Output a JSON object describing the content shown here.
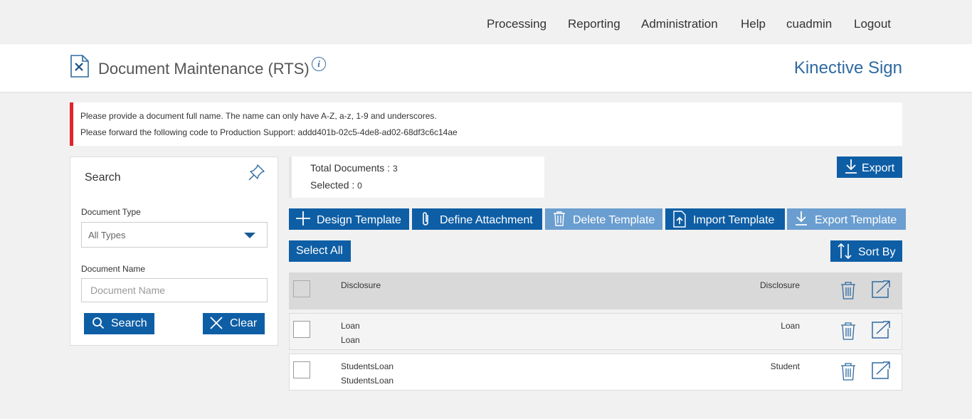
{
  "nav": {
    "items": [
      "Processing",
      "Reporting",
      "Administration",
      "Help",
      "cuadmin",
      "Logout"
    ]
  },
  "header": {
    "title": "Document Maintenance (RTS)",
    "info_glyph": "i",
    "brand": "Kinective Sign"
  },
  "alert": {
    "line1": "Please provide a document full name. The name can only have A-Z, a-z, 1-9 and underscores.",
    "line2": "Please forward the following code to Production Support: addd401b-02c5-4de8-ad02-68df3c6c14ae",
    "accent": "#e0262b"
  },
  "search": {
    "title": "Search",
    "doc_type_label": "Document Type",
    "doc_type_value": "All Types",
    "doc_name_label": "Document Name",
    "doc_name_placeholder": "Document Name",
    "doc_name_value": "",
    "search_button": "Search",
    "clear_button": "Clear"
  },
  "summary": {
    "total_label": "Total Documents : ",
    "total_value": "3",
    "selected_label": "Selected : ",
    "selected_value": "0"
  },
  "toolbar": {
    "export": "Export",
    "design_template": "Design Template",
    "define_attachment": "Define Attachment",
    "delete_template": "Delete Template",
    "import_template": "Import Template",
    "export_template": "Export Template",
    "select_all": "Select All",
    "sort_by": "Sort By"
  },
  "documents": [
    {
      "name": "Disclosure",
      "subname": "",
      "type": "Disclosure"
    },
    {
      "name": "Loan",
      "subname": "Loan",
      "type": "Loan"
    },
    {
      "name": "StudentsLoan",
      "subname": "StudentsLoan",
      "type": "Student"
    }
  ],
  "colors": {
    "primary": "#0e5ea5",
    "primary_disabled": "#6a9ed0",
    "brand": "#2f6aa0"
  },
  "icons": [
    "document-tools-icon",
    "info-icon",
    "pin-icon",
    "search-icon",
    "close-icon",
    "download-icon",
    "plus-icon",
    "paperclip-icon",
    "trash-icon",
    "upload-icon",
    "sort-icon",
    "open-external-icon"
  ]
}
